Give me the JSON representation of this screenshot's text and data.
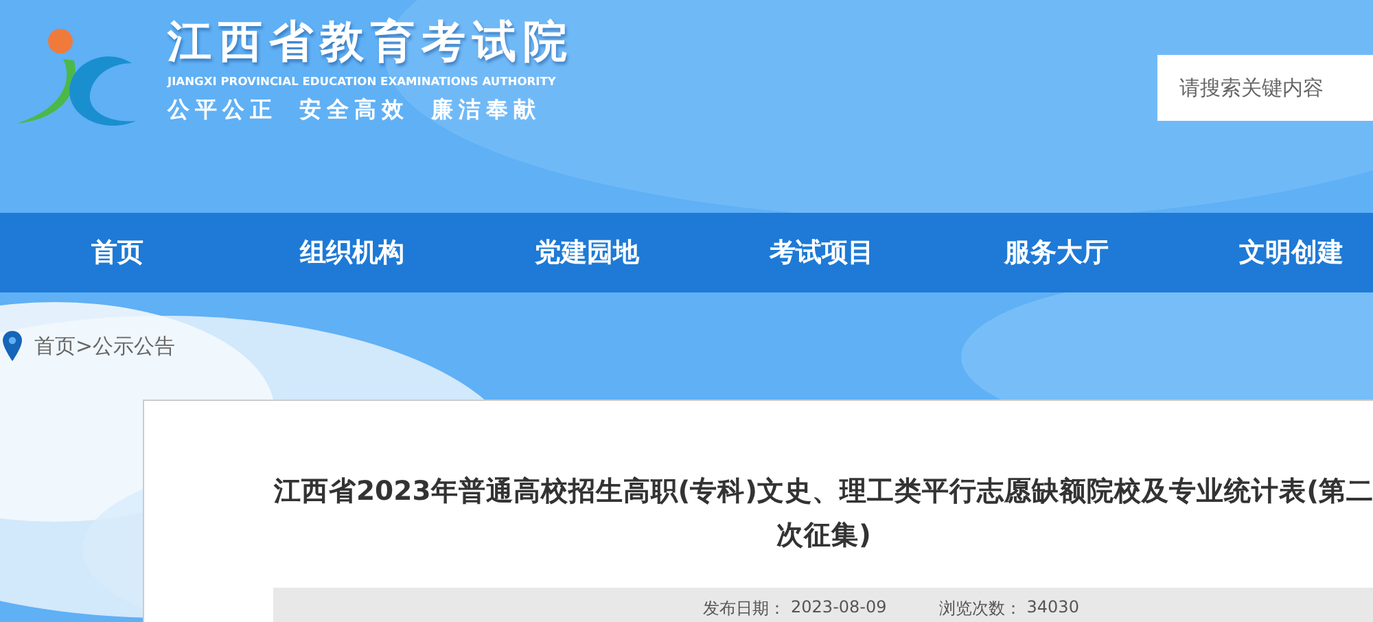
{
  "header": {
    "site_title": "江西省教育考试院",
    "site_subtitle": "JIANGXI PROVINCIAL EDUCATION EXAMINATIONS AUTHORITY",
    "motto": [
      "公平公正",
      "安全高效",
      "廉洁奉献"
    ],
    "search": {
      "placeholder": "请搜索关键内容"
    }
  },
  "nav": [
    "首页",
    "组织机构",
    "党建园地",
    "考试项目",
    "服务大厅",
    "文明创建"
  ],
  "breadcrumb": [
    "首页",
    ">",
    "公示公告"
  ],
  "article": {
    "title": "江西省2023年普通高校招生高职(专科)文史、理工类平行志愿缺额院校及专业统计表(第二次征集)",
    "meta": [
      {
        "label": "发布日期：",
        "value": "2023-08-09"
      },
      {
        "label": "浏览次数：",
        "value": "34030"
      }
    ]
  }
}
